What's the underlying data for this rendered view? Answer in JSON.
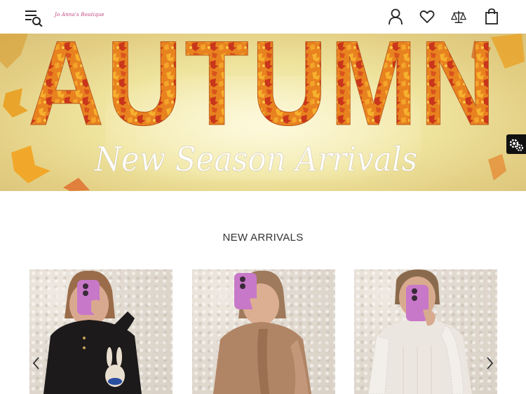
{
  "header": {
    "logo_text": "Jo Anna's Boutique",
    "icons": [
      "menu-search-icon",
      "account-icon",
      "wishlist-icon",
      "compare-icon",
      "cart-icon"
    ]
  },
  "hero": {
    "headline": "AUTUMN",
    "subheadline": "New Season Arrivals"
  },
  "section": {
    "title": "NEW ARRIVALS"
  },
  "products": [
    {
      "name": "product-black-bunny-top",
      "top_color": "#1c1a1a"
    },
    {
      "name": "product-camel-ruffle-blouse",
      "top_color": "#b08566"
    },
    {
      "name": "product-ivory-lace-sleeve-top",
      "top_color": "#ebe6df"
    }
  ],
  "colors": {
    "phone_case": "#c878c8",
    "logo": "#c2407c",
    "leaf_orange": "#e8781e"
  }
}
